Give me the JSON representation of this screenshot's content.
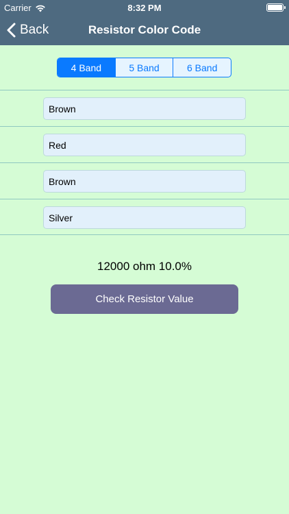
{
  "status_bar": {
    "carrier": "Carrier",
    "time": "8:32 PM"
  },
  "nav": {
    "back_label": "Back",
    "title": "Resistor Color Code"
  },
  "band_selector": {
    "options": [
      "4 Band",
      "5 Band",
      "6 Band"
    ],
    "selected": "4 Band"
  },
  "bands": [
    {
      "value": "Brown"
    },
    {
      "value": "Red"
    },
    {
      "value": "Brown"
    },
    {
      "value": "Silver"
    }
  ],
  "result": "12000 ohm 10.0%",
  "check_button_label": "Check Resistor Value",
  "colors": {
    "background": "#d5fcd5",
    "nav_bar": "#4e6a80",
    "accent": "#0a7aff",
    "button": "#6b6a93"
  }
}
